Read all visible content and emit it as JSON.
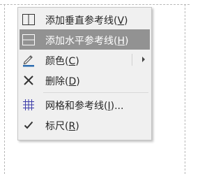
{
  "menu": {
    "items": [
      {
        "name": "vertical-guide",
        "text": "添加垂直参考线(",
        "key": "V",
        "tail": ")",
        "icon": "vertical-guide-icon"
      },
      {
        "name": "horizontal-guide",
        "text": "添加水平参考线(",
        "key": "H",
        "tail": ")",
        "icon": "horizontal-guide-icon",
        "highlighted": true
      },
      {
        "name": "color",
        "text": "颜色(",
        "key": "C",
        "tail": ")",
        "icon": "pen-color-icon",
        "submenu": true
      },
      {
        "name": "delete",
        "text": "删除(",
        "key": "D",
        "tail": ")",
        "icon": "delete-x-icon"
      },
      {
        "name": "grid-guides",
        "text": "网格和参考线(",
        "key": "I",
        "tail": ")...",
        "icon": "grid-icon"
      },
      {
        "name": "ruler",
        "text": "标尺(",
        "key": "R",
        "tail": ")",
        "icon": "checkmark-icon"
      }
    ]
  },
  "colors": {
    "highlight": "#929292",
    "menu_bg": "#f0f0f0",
    "pen_accent": "#2b6cb0"
  }
}
